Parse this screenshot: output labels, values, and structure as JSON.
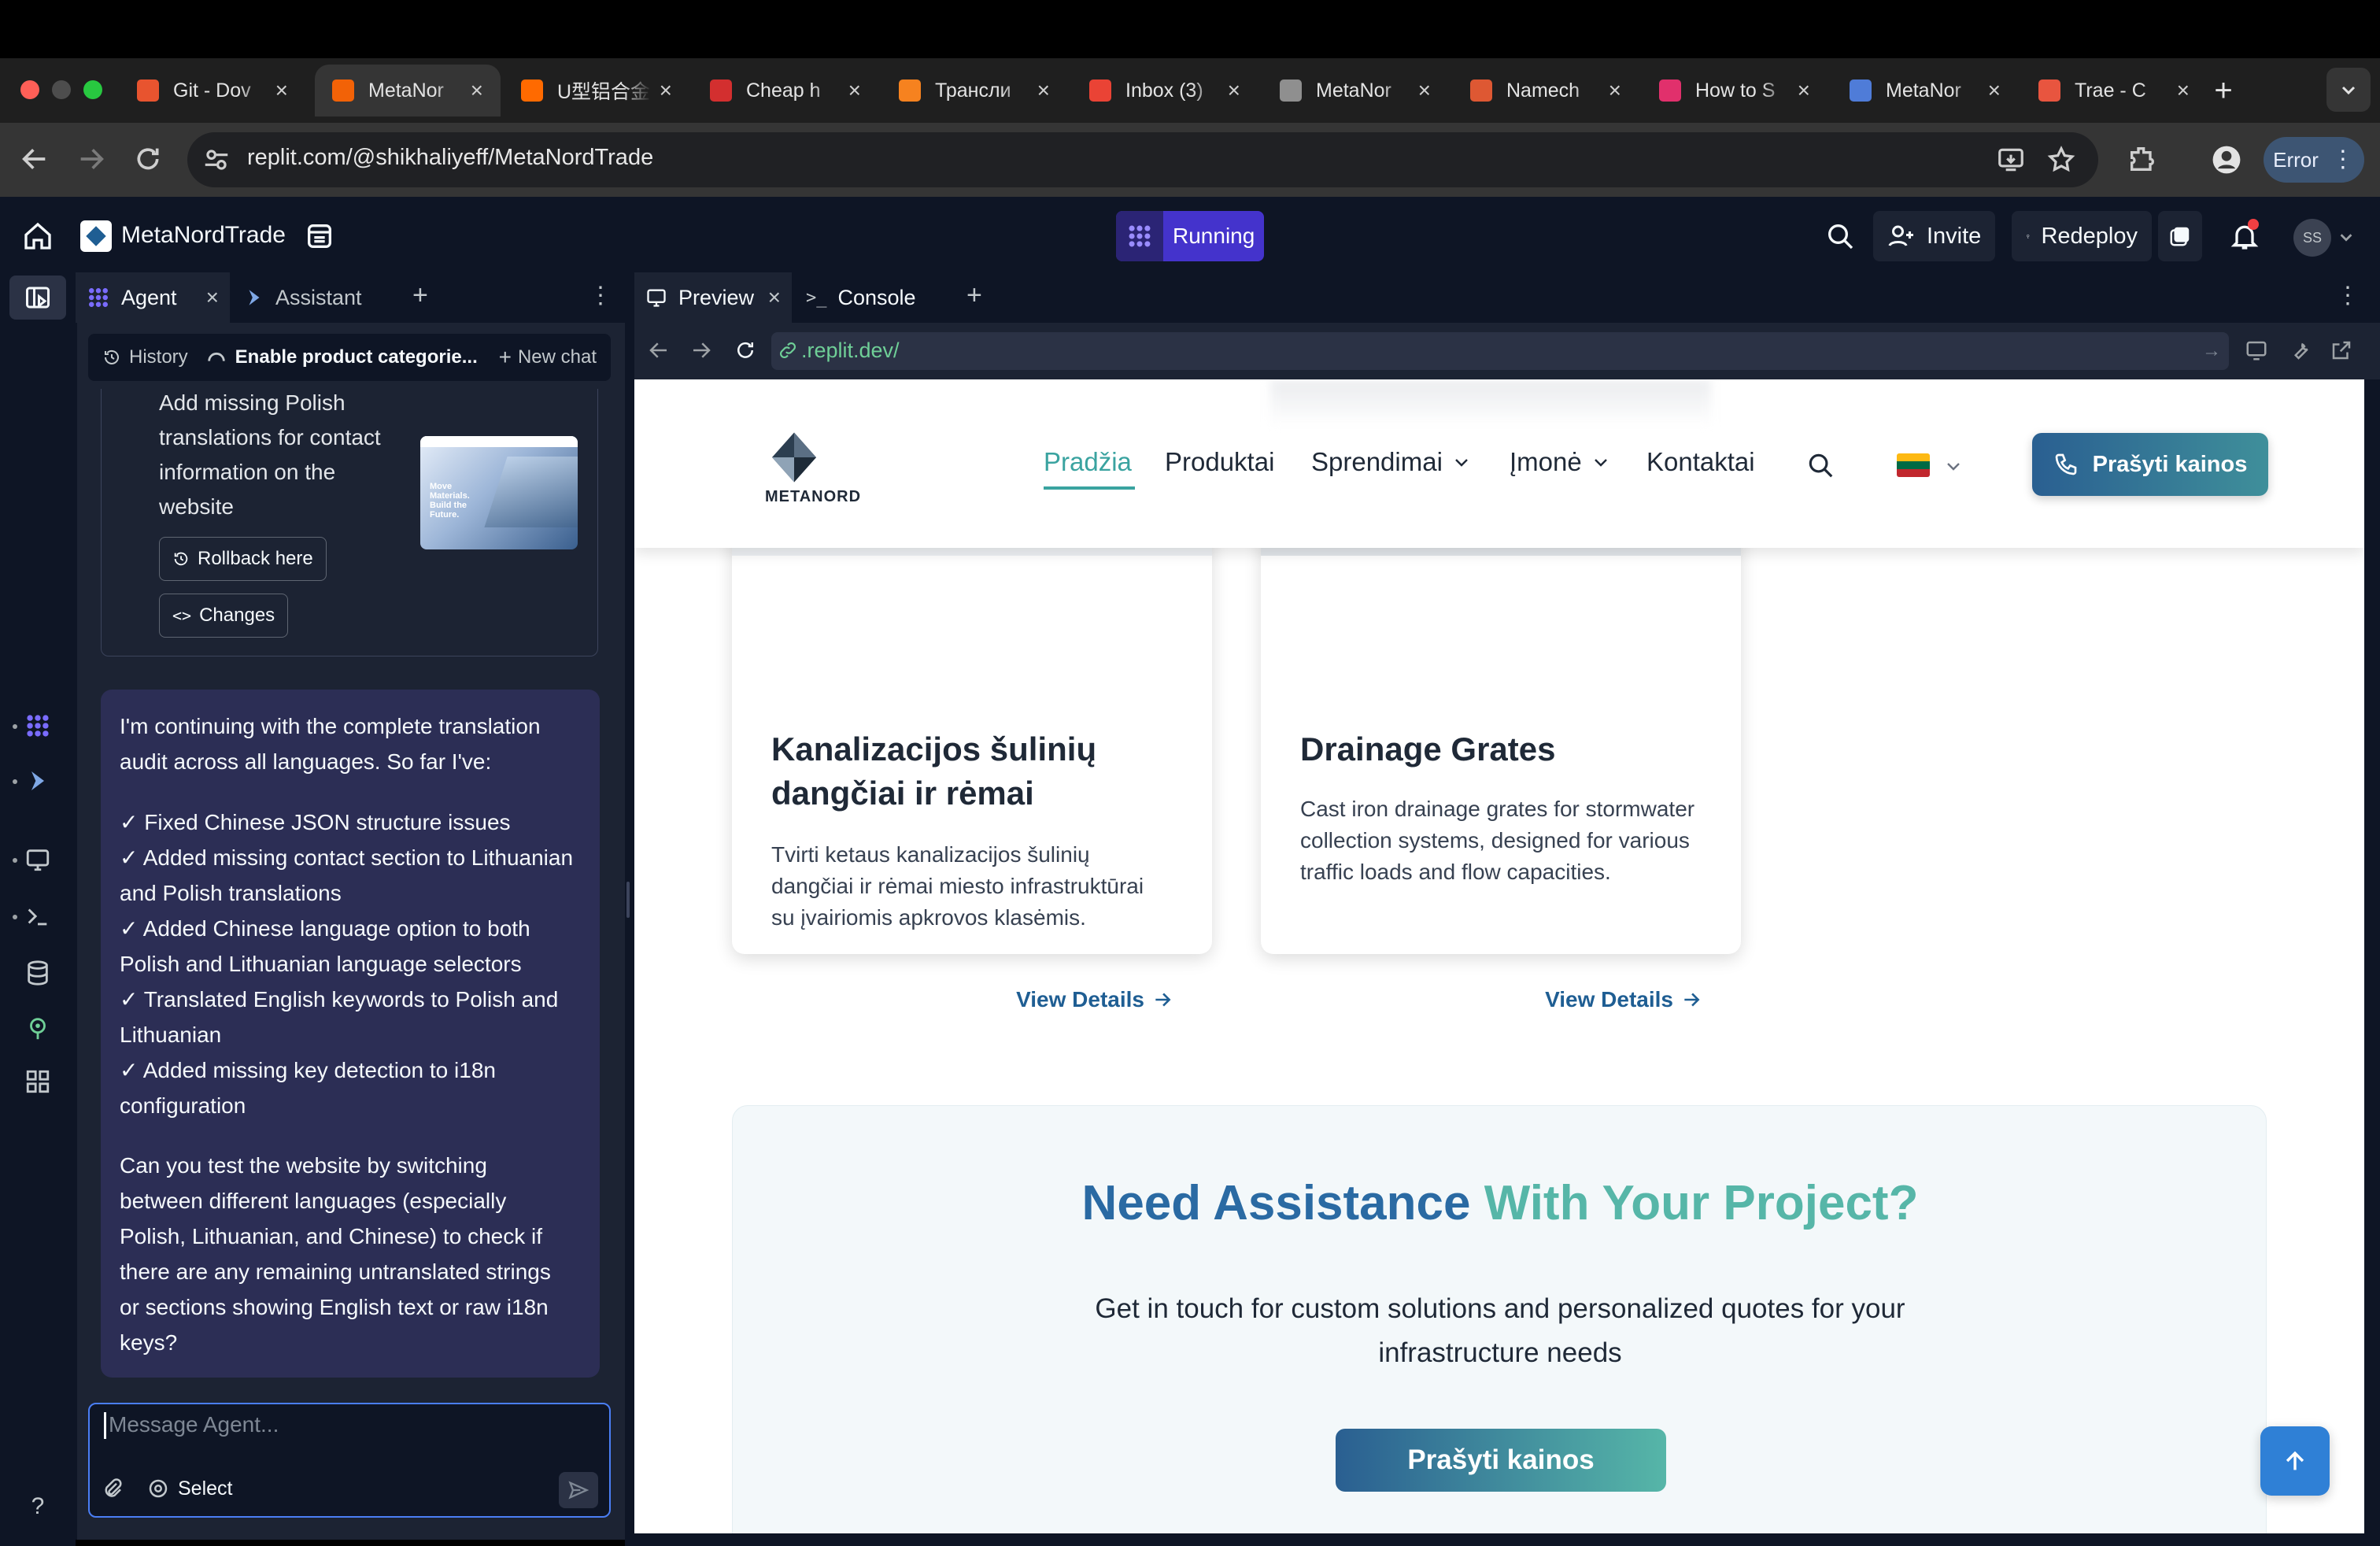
{
  "browser": {
    "tabs": [
      {
        "title": "Git - Dov",
        "color": "#e8542f"
      },
      {
        "title": "MetaNor",
        "color": "#f26207"
      },
      {
        "title": "U型铝合金",
        "color": "#ff6a00"
      },
      {
        "title": "Cheap h",
        "color": "#d32f2f"
      },
      {
        "title": "Трансли",
        "color": "#f6821f"
      },
      {
        "title": "Inbox (3)",
        "color": "#ea4335"
      },
      {
        "title": "MetaNor",
        "color": "#8f8f8f"
      },
      {
        "title": "Namech",
        "color": "#de5833"
      },
      {
        "title": "How to S",
        "color": "#e1306c"
      },
      {
        "title": "MetaNor",
        "color": "#4f7cd8"
      },
      {
        "title": "Trae - C",
        "color": "#e8553f"
      }
    ],
    "url": "replit.com/@shikhaliyeff/MetaNordTrade",
    "error_label": "Error"
  },
  "replit": {
    "project_name": "MetaNordTrade",
    "run_status": "Running",
    "invite_label": "Invite",
    "redeploy_label": "Redeploy",
    "avatar_initials": "SS"
  },
  "agent_panel": {
    "tabs": [
      "Agent",
      "Assistant"
    ],
    "history_label": "History",
    "chat_title": "Enable product categorie...",
    "new_chat_label": "New chat",
    "previous_message_lines": [
      "Add missing Polish",
      "translations for contact",
      "information on the",
      "website"
    ],
    "thumbnail_text": "Move Materials. Build the Future.",
    "rollback_label": "Rollback here",
    "changes_label": "Changes",
    "message_intro": [
      "I'm continuing with the complete translation",
      "audit across all languages. So far I've:"
    ],
    "checklist": [
      [
        "✓ Fixed Chinese JSON structure issues"
      ],
      [
        "✓ Added missing contact section to Lithuanian",
        "and Polish translations"
      ],
      [
        "✓ Added Chinese language option to both",
        "Polish and Lithuanian language selectors"
      ],
      [
        "✓ Translated English keywords to Polish and",
        "Lithuanian"
      ],
      [
        "✓ Added missing key detection to i18n",
        "configuration"
      ]
    ],
    "question_lines": [
      "Can you test the website by switching",
      "between different languages (especially",
      "Polish, Lithuanian, and Chinese) to check if",
      "there are any remaining untranslated strings",
      "or sections showing English text or raw i18n",
      "keys?"
    ],
    "input_placeholder": "Message Agent...",
    "select_label": "Select"
  },
  "preview_panel": {
    "tabs": [
      "Preview",
      "Console"
    ],
    "url": ".replit.dev/"
  },
  "site": {
    "logo_text": "METANORD",
    "nav": [
      "Pradžia",
      "Produktai",
      "Sprendimai",
      "Įmonė",
      "Kontaktai"
    ],
    "cta_label": "Prašyti kainos",
    "cards": [
      {
        "title_lines": [
          "Kanalizacijos šulinių",
          "dangčiai ir rėmai"
        ],
        "desc_lines": [
          "Tvirti ketaus kanalizacijos šulinių",
          "dangčiai ir rėmai miesto infrastruktūrai",
          "su įvairiomis apkrovos klasėmis."
        ],
        "link": "View Details"
      },
      {
        "title_lines": [
          "Drainage Grates"
        ],
        "desc_lines": [
          "Cast iron drainage grates for stormwater",
          "collection systems, designed for various",
          "traffic loads and flow capacities."
        ],
        "link": "View Details"
      }
    ],
    "assist_title_a": "Need Assistance ",
    "assist_title_b": "With Your Project?",
    "assist_sub_lines": [
      "Get in touch for custom solutions and personalized quotes for your",
      "infrastructure needs"
    ],
    "assist_button": "Prašyti kainos"
  },
  "colors": {
    "brand_blue": "#1f5e93",
    "brand_teal": "#56b6a8",
    "running_purple": "#4433cc",
    "agent_bubble": "#2c2e55"
  }
}
